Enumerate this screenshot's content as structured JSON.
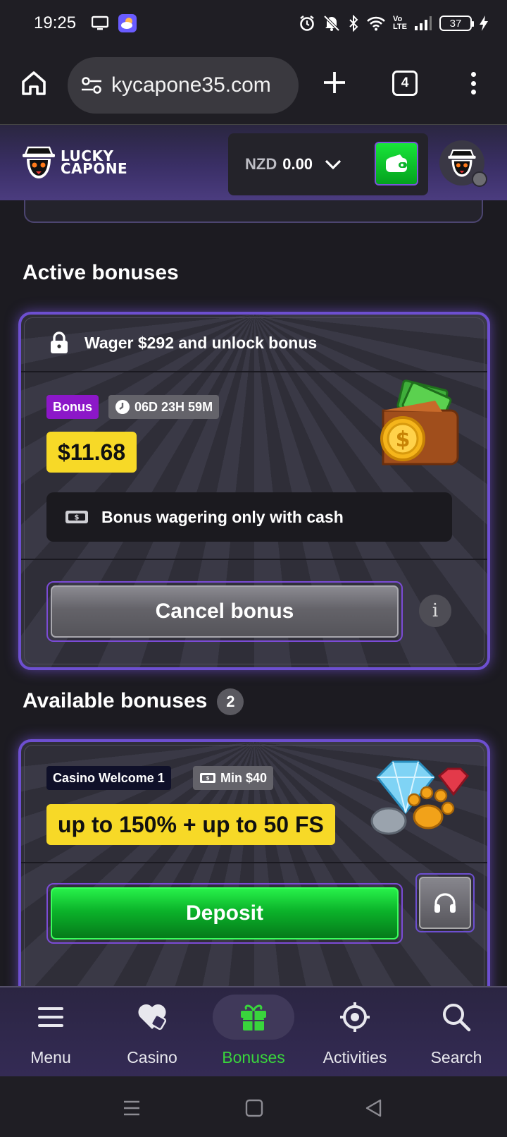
{
  "status_bar": {
    "time": "19:25",
    "network": "Vo LTE",
    "battery": "37"
  },
  "browser": {
    "url": "kycapone35.com",
    "tab_count": "4"
  },
  "header": {
    "logo_line1": "LUCKY",
    "logo_line2": "CAPONE",
    "currency": "NZD",
    "balance": "0.00"
  },
  "active_section": {
    "title": "Active bonuses",
    "card": {
      "wager_text": "Wager $292 and unlock bonus",
      "tag_label": "Bonus",
      "timer": "06D 23H 59M",
      "amount": "$11.68",
      "info_text": "Bonus wagering only with cash",
      "cancel_label": "Cancel bonus",
      "info_icon": "i"
    }
  },
  "available_section": {
    "title": "Available bonuses",
    "count": "2",
    "card": {
      "tag_label": "Casino Welcome 1",
      "min_label": "Min $40",
      "offer": "up to 150% + up to 50 FS",
      "deposit_label": "Deposit"
    }
  },
  "bottom_nav": {
    "items": [
      {
        "label": "Menu",
        "icon": "menu-icon"
      },
      {
        "label": "Casino",
        "icon": "heart-icon"
      },
      {
        "label": "Bonuses",
        "icon": "gift-icon",
        "active": true
      },
      {
        "label": "Activities",
        "icon": "target-icon"
      },
      {
        "label": "Search",
        "icon": "search-icon"
      }
    ]
  },
  "colors": {
    "accent_green": "#39d53c",
    "card_border": "#6d4fd0",
    "amount_yellow": "#f7d927",
    "bonus_purple": "#8c17c8"
  }
}
